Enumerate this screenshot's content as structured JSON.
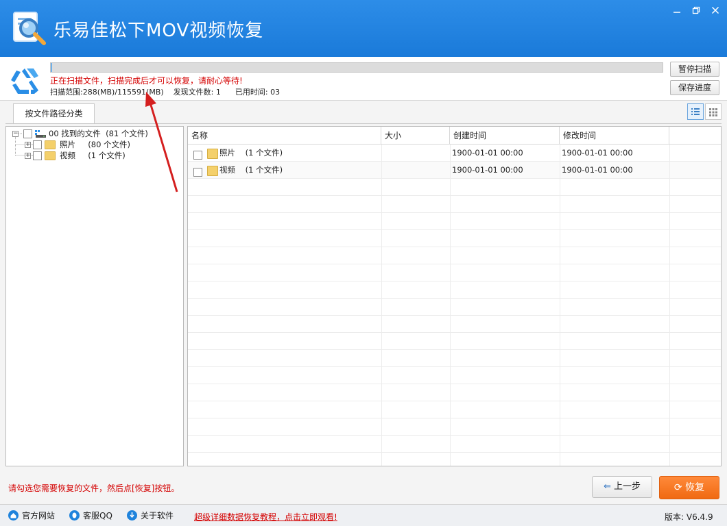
{
  "window": {
    "title": "乐易佳松下MOV视频恢复",
    "minimize_icon": "minimize-icon",
    "restore_icon": "restore-icon",
    "close_icon": "close-icon"
  },
  "scan": {
    "progress_fraction": 0.002,
    "message": "正在扫描文件，扫描完成后才可以恢复，请耐心等待!",
    "range_label": "扫描范围:",
    "range_value": "288(MB)/115591(MB)",
    "found_label": "发现文件数:",
    "found_value": "1",
    "elapsed_label": "已用时间:",
    "elapsed_value": "03",
    "pause_button": "暂停扫描",
    "save_button": "保存进度"
  },
  "tabs": [
    {
      "label": "按文件路径分类"
    }
  ],
  "tree": {
    "root": {
      "name": "00 找到的文件",
      "count": "(81 个文件)"
    },
    "children": [
      {
        "name": "照片",
        "count": "(80 个文件)"
      },
      {
        "name": "视频",
        "count": "(1 个文件)"
      }
    ]
  },
  "list": {
    "columns": [
      "名称",
      "大小",
      "创建时间",
      "修改时间"
    ],
    "rows": [
      {
        "name": "照片",
        "info": "(1 个文件)",
        "size": "",
        "created": "1900-01-01 00:00",
        "modified": "1900-01-01 00:00"
      },
      {
        "name": "视频",
        "info": "(1 个文件)",
        "size": "",
        "created": "1900-01-01 00:00",
        "modified": "1900-01-01 00:00"
      }
    ]
  },
  "footer": {
    "hint": "请勾选您需要恢复的文件，然后点[恢复]按钮。",
    "prev_button": "上一步",
    "recover_button": "恢复"
  },
  "statusbar": {
    "website": "官方网站",
    "qq": "客服QQ",
    "about": "关于软件",
    "tutorial_link": "超级详细数据恢复教程，点击立即观看!",
    "version": "版本: V6.4.9"
  },
  "colors": {
    "titlebar": "#1a7ad9",
    "accent": "#f06a12",
    "warning_text": "#d40000"
  }
}
